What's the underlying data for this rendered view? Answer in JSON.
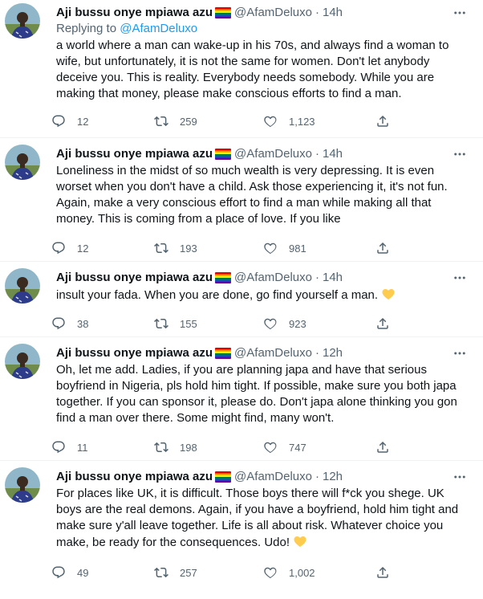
{
  "tweets": [
    {
      "name": "Aji bussu onye mpiawa azu",
      "handle": "@AfamDeluxo",
      "time": "14h",
      "replying_prefix": "Replying to",
      "replying_to": "@AfamDeluxo",
      "text": "a world where a man can wake-up in his 70s, and always find a woman to wife, but unfortunately, it is not the same for women. Don't let anybody deceive you. This is reality. Everybody needs somebody. While you are making that money, please make conscious efforts to find a man.",
      "replies": "12",
      "retweets": "259",
      "likes": "1,123"
    },
    {
      "name": "Aji bussu onye mpiawa azu",
      "handle": "@AfamDeluxo",
      "time": "14h",
      "text": "Loneliness in the midst of so much wealth is very depressing. It is even worset when you don't have a child. Ask those experiencing it, it's not fun. Again, make a very conscious effort to find a man while making all that money. This is coming from a place of love. If you like",
      "replies": "12",
      "retweets": "193",
      "likes": "981"
    },
    {
      "name": "Aji bussu onye mpiawa azu",
      "handle": "@AfamDeluxo",
      "time": "14h",
      "text": "insult your fada. When you are done, go find yourself a man.",
      "replies": "38",
      "retweets": "155",
      "likes": "923"
    },
    {
      "name": "Aji bussu onye mpiawa azu",
      "handle": "@AfamDeluxo",
      "time": "12h",
      "text": "Oh, let me add. Ladies, if you are planning japa and have that serious boyfriend in Nigeria, pls hold him tight. If possible, make sure you both japa together. If you can sponsor it, please do. Don't japa alone thinking you gon find a man over there.  Some might find, many won't.",
      "replies": "11",
      "retweets": "198",
      "likes": "747"
    },
    {
      "name": "Aji bussu onye mpiawa azu",
      "handle": "@AfamDeluxo",
      "time": "12h",
      "text": "For places like UK, it is difficult. Those boys there will f*ck you shege. UK boys are the real demons. Again, if you have a boyfriend, hold him tight and make sure y'all leave together. Life is all about risk. Whatever choice you make, be ready for the consequences. Udo!",
      "replies": "49",
      "retweets": "257",
      "likes": "1,002"
    }
  ],
  "icons": {
    "more": "more-icon",
    "reply": "reply-icon",
    "retweet": "retweet-icon",
    "like": "like-icon",
    "share": "share-icon",
    "flag": "rainbow-flag-icon",
    "heart_emoji": "yellow-heart-icon"
  },
  "colors": {
    "text": "#0f1419",
    "secondary": "#536471",
    "link": "#1d9bf0",
    "heart_emoji": "#ffcc4d"
  }
}
